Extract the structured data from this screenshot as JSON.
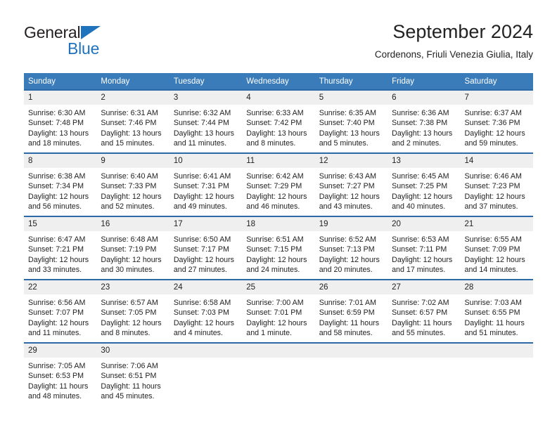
{
  "brand": {
    "name_part1": "General",
    "name_part2": "Blue",
    "triangle_color": "#1f73bd"
  },
  "header": {
    "title": "September 2024",
    "subtitle": "Cordenons, Friuli Venezia Giulia, Italy"
  },
  "theme": {
    "header_blue": "#3a7cb9",
    "row_border_blue": "#2c69a8",
    "daynum_background": "#efefef",
    "text_color": "#222222"
  },
  "weekdays": [
    "Sunday",
    "Monday",
    "Tuesday",
    "Wednesday",
    "Thursday",
    "Friday",
    "Saturday"
  ],
  "labels": {
    "sunrise": "Sunrise:",
    "sunset": "Sunset:",
    "daylight": "Daylight:"
  },
  "weeks": [
    [
      {
        "day": "1",
        "sunrise": "Sunrise: 6:30 AM",
        "sunset": "Sunset: 7:48 PM",
        "daylight_line1": "Daylight: 13 hours",
        "daylight_line2": "and 18 minutes."
      },
      {
        "day": "2",
        "sunrise": "Sunrise: 6:31 AM",
        "sunset": "Sunset: 7:46 PM",
        "daylight_line1": "Daylight: 13 hours",
        "daylight_line2": "and 15 minutes."
      },
      {
        "day": "3",
        "sunrise": "Sunrise: 6:32 AM",
        "sunset": "Sunset: 7:44 PM",
        "daylight_line1": "Daylight: 13 hours",
        "daylight_line2": "and 11 minutes."
      },
      {
        "day": "4",
        "sunrise": "Sunrise: 6:33 AM",
        "sunset": "Sunset: 7:42 PM",
        "daylight_line1": "Daylight: 13 hours",
        "daylight_line2": "and 8 minutes."
      },
      {
        "day": "5",
        "sunrise": "Sunrise: 6:35 AM",
        "sunset": "Sunset: 7:40 PM",
        "daylight_line1": "Daylight: 13 hours",
        "daylight_line2": "and 5 minutes."
      },
      {
        "day": "6",
        "sunrise": "Sunrise: 6:36 AM",
        "sunset": "Sunset: 7:38 PM",
        "daylight_line1": "Daylight: 13 hours",
        "daylight_line2": "and 2 minutes."
      },
      {
        "day": "7",
        "sunrise": "Sunrise: 6:37 AM",
        "sunset": "Sunset: 7:36 PM",
        "daylight_line1": "Daylight: 12 hours",
        "daylight_line2": "and 59 minutes."
      }
    ],
    [
      {
        "day": "8",
        "sunrise": "Sunrise: 6:38 AM",
        "sunset": "Sunset: 7:34 PM",
        "daylight_line1": "Daylight: 12 hours",
        "daylight_line2": "and 56 minutes."
      },
      {
        "day": "9",
        "sunrise": "Sunrise: 6:40 AM",
        "sunset": "Sunset: 7:33 PM",
        "daylight_line1": "Daylight: 12 hours",
        "daylight_line2": "and 52 minutes."
      },
      {
        "day": "10",
        "sunrise": "Sunrise: 6:41 AM",
        "sunset": "Sunset: 7:31 PM",
        "daylight_line1": "Daylight: 12 hours",
        "daylight_line2": "and 49 minutes."
      },
      {
        "day": "11",
        "sunrise": "Sunrise: 6:42 AM",
        "sunset": "Sunset: 7:29 PM",
        "daylight_line1": "Daylight: 12 hours",
        "daylight_line2": "and 46 minutes."
      },
      {
        "day": "12",
        "sunrise": "Sunrise: 6:43 AM",
        "sunset": "Sunset: 7:27 PM",
        "daylight_line1": "Daylight: 12 hours",
        "daylight_line2": "and 43 minutes."
      },
      {
        "day": "13",
        "sunrise": "Sunrise: 6:45 AM",
        "sunset": "Sunset: 7:25 PM",
        "daylight_line1": "Daylight: 12 hours",
        "daylight_line2": "and 40 minutes."
      },
      {
        "day": "14",
        "sunrise": "Sunrise: 6:46 AM",
        "sunset": "Sunset: 7:23 PM",
        "daylight_line1": "Daylight: 12 hours",
        "daylight_line2": "and 37 minutes."
      }
    ],
    [
      {
        "day": "15",
        "sunrise": "Sunrise: 6:47 AM",
        "sunset": "Sunset: 7:21 PM",
        "daylight_line1": "Daylight: 12 hours",
        "daylight_line2": "and 33 minutes."
      },
      {
        "day": "16",
        "sunrise": "Sunrise: 6:48 AM",
        "sunset": "Sunset: 7:19 PM",
        "daylight_line1": "Daylight: 12 hours",
        "daylight_line2": "and 30 minutes."
      },
      {
        "day": "17",
        "sunrise": "Sunrise: 6:50 AM",
        "sunset": "Sunset: 7:17 PM",
        "daylight_line1": "Daylight: 12 hours",
        "daylight_line2": "and 27 minutes."
      },
      {
        "day": "18",
        "sunrise": "Sunrise: 6:51 AM",
        "sunset": "Sunset: 7:15 PM",
        "daylight_line1": "Daylight: 12 hours",
        "daylight_line2": "and 24 minutes."
      },
      {
        "day": "19",
        "sunrise": "Sunrise: 6:52 AM",
        "sunset": "Sunset: 7:13 PM",
        "daylight_line1": "Daylight: 12 hours",
        "daylight_line2": "and 20 minutes."
      },
      {
        "day": "20",
        "sunrise": "Sunrise: 6:53 AM",
        "sunset": "Sunset: 7:11 PM",
        "daylight_line1": "Daylight: 12 hours",
        "daylight_line2": "and 17 minutes."
      },
      {
        "day": "21",
        "sunrise": "Sunrise: 6:55 AM",
        "sunset": "Sunset: 7:09 PM",
        "daylight_line1": "Daylight: 12 hours",
        "daylight_line2": "and 14 minutes."
      }
    ],
    [
      {
        "day": "22",
        "sunrise": "Sunrise: 6:56 AM",
        "sunset": "Sunset: 7:07 PM",
        "daylight_line1": "Daylight: 12 hours",
        "daylight_line2": "and 11 minutes."
      },
      {
        "day": "23",
        "sunrise": "Sunrise: 6:57 AM",
        "sunset": "Sunset: 7:05 PM",
        "daylight_line1": "Daylight: 12 hours",
        "daylight_line2": "and 8 minutes."
      },
      {
        "day": "24",
        "sunrise": "Sunrise: 6:58 AM",
        "sunset": "Sunset: 7:03 PM",
        "daylight_line1": "Daylight: 12 hours",
        "daylight_line2": "and 4 minutes."
      },
      {
        "day": "25",
        "sunrise": "Sunrise: 7:00 AM",
        "sunset": "Sunset: 7:01 PM",
        "daylight_line1": "Daylight: 12 hours",
        "daylight_line2": "and 1 minute."
      },
      {
        "day": "26",
        "sunrise": "Sunrise: 7:01 AM",
        "sunset": "Sunset: 6:59 PM",
        "daylight_line1": "Daylight: 11 hours",
        "daylight_line2": "and 58 minutes."
      },
      {
        "day": "27",
        "sunrise": "Sunrise: 7:02 AM",
        "sunset": "Sunset: 6:57 PM",
        "daylight_line1": "Daylight: 11 hours",
        "daylight_line2": "and 55 minutes."
      },
      {
        "day": "28",
        "sunrise": "Sunrise: 7:03 AM",
        "sunset": "Sunset: 6:55 PM",
        "daylight_line1": "Daylight: 11 hours",
        "daylight_line2": "and 51 minutes."
      }
    ],
    [
      {
        "day": "29",
        "sunrise": "Sunrise: 7:05 AM",
        "sunset": "Sunset: 6:53 PM",
        "daylight_line1": "Daylight: 11 hours",
        "daylight_line2": "and 48 minutes."
      },
      {
        "day": "30",
        "sunrise": "Sunrise: 7:06 AM",
        "sunset": "Sunset: 6:51 PM",
        "daylight_line1": "Daylight: 11 hours",
        "daylight_line2": "and 45 minutes."
      },
      {
        "day": "",
        "sunrise": "",
        "sunset": "",
        "daylight_line1": "",
        "daylight_line2": ""
      },
      {
        "day": "",
        "sunrise": "",
        "sunset": "",
        "daylight_line1": "",
        "daylight_line2": ""
      },
      {
        "day": "",
        "sunrise": "",
        "sunset": "",
        "daylight_line1": "",
        "daylight_line2": ""
      },
      {
        "day": "",
        "sunrise": "",
        "sunset": "",
        "daylight_line1": "",
        "daylight_line2": ""
      },
      {
        "day": "",
        "sunrise": "",
        "sunset": "",
        "daylight_line1": "",
        "daylight_line2": ""
      }
    ]
  ]
}
